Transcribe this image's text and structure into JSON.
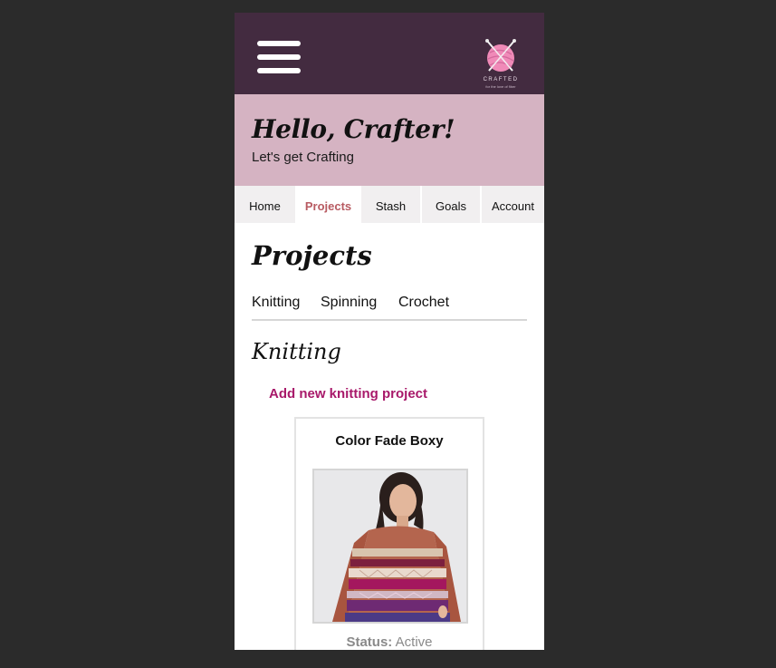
{
  "header": {
    "logo_text": "CRAFTED",
    "logo_tagline": "for the love of fiber"
  },
  "hero": {
    "greeting": "Hello, Crafter!",
    "subtitle": "Let's get Crafting"
  },
  "tabs": [
    {
      "label": "Home",
      "active": false
    },
    {
      "label": "Projects",
      "active": true
    },
    {
      "label": "Stash",
      "active": false
    },
    {
      "label": "Goals",
      "active": false
    },
    {
      "label": "Account",
      "active": false
    }
  ],
  "page": {
    "title": "Projects",
    "subnav": [
      "Knitting",
      "Spinning",
      "Crochet"
    ],
    "section_title": "Knitting",
    "add_link": "Add new knitting project"
  },
  "project_card": {
    "title": "Color Fade Boxy",
    "status_label": "Status:",
    "status_value": "Active"
  },
  "colors": {
    "topbar": "#432b40",
    "hero": "#d5b3c2",
    "accent": "#a8196a",
    "active_tab": "#b85b62"
  }
}
